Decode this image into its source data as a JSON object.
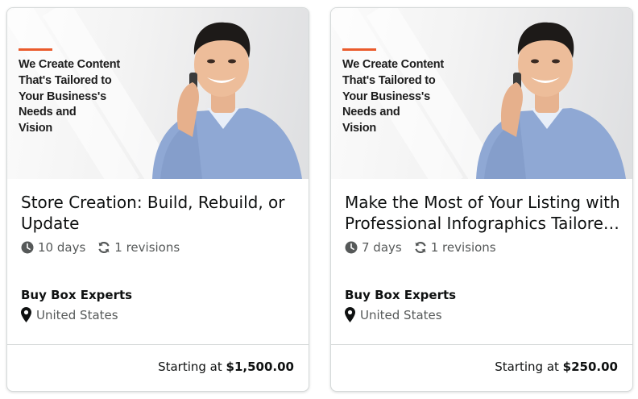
{
  "cards": [
    {
      "image": {
        "tagline_lines": [
          "We Create Content",
          "That's Tailored to",
          "Your Business's",
          "Needs and",
          "Vision"
        ]
      },
      "title": "Store Creation: Build, Rebuild, or Update",
      "duration": "10 days",
      "revisions": "1 revisions",
      "seller": "Buy Box Experts",
      "location": "United States",
      "price_prefix": "Starting at",
      "price": "$1,500.00"
    },
    {
      "image": {
        "tagline_lines": [
          "We Create Content",
          "That's Tailored to",
          "Your Business's",
          "Needs and",
          "Vision"
        ]
      },
      "title": "Make the Most of Your Listing with Professional Infographics Tailored to Your Brand",
      "duration": "7 days",
      "revisions": "1 revisions",
      "seller": "Buy Box Experts",
      "location": "United States",
      "price_prefix": "Starting at",
      "price": "$250.00"
    }
  ],
  "colors": {
    "accent": "#ea5b2c",
    "text_primary": "#0f1111",
    "text_secondary": "#565959",
    "border": "#d5d9d9",
    "icon": "#565959"
  },
  "icons": {
    "duration": "clock-icon",
    "revisions": "refresh-icon",
    "location": "map-pin-icon"
  }
}
